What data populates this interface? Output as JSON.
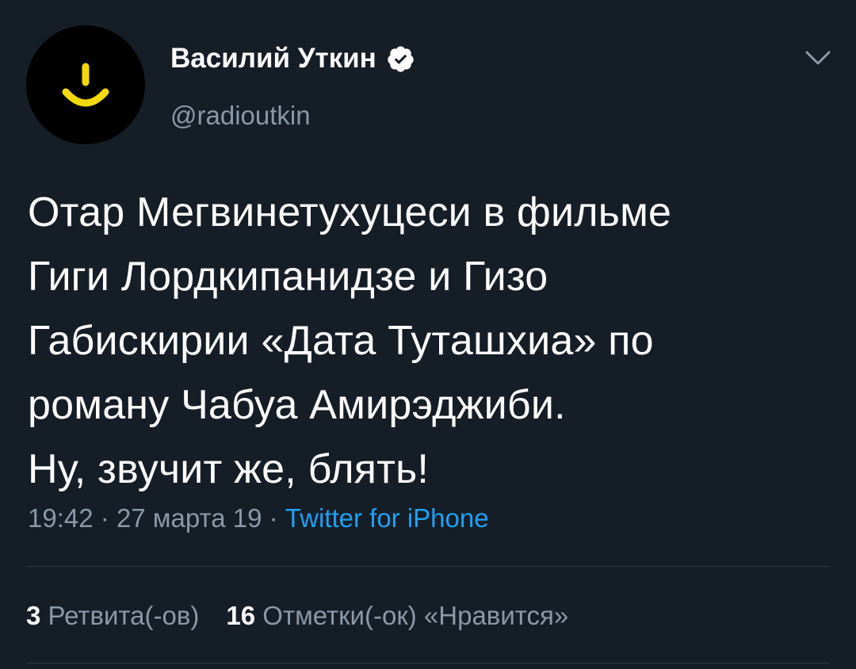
{
  "tweet": {
    "author": {
      "name": "Василий Уткин",
      "handle": "@radioutkin",
      "verified": true,
      "avatar_icon": "smile-logo-icon"
    },
    "text": "Отар Мегвинетухуцеси в фильме\nГиги Лордкипанидзе и Гизо\nГабискирии «Дата Туташхиа» по\nроману Чабуа Амирэджиби.\nНу, звучит же, блять!",
    "time": "19:42",
    "date": "27 марта 19",
    "separator": "·",
    "source": "Twitter for iPhone",
    "stats": {
      "retweets_count": "3",
      "retweets_label": "Ретвита(-ов)",
      "likes_count": "16",
      "likes_label": "Отметки(-ок) «Нравится»"
    }
  },
  "colors": {
    "background": "#151d27",
    "text": "#ffffff",
    "secondary": "#8b98a6",
    "link": "#1da1f2",
    "avatar_accent": "#f5d90a",
    "divider": "#2f3a46"
  }
}
